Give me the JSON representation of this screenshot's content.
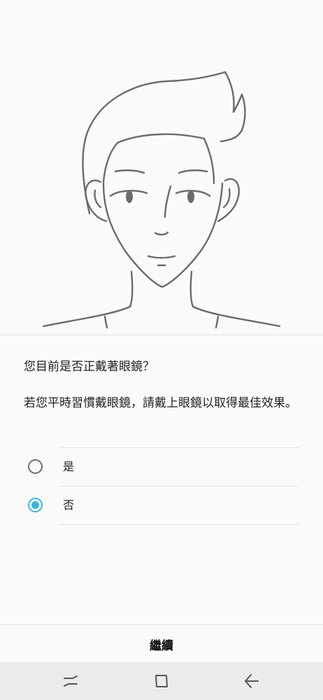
{
  "question": "您目前是否正戴著眼鏡？",
  "hint": "若您平時習慣戴眼鏡，請戴上眼鏡以取得最佳效果。",
  "options": [
    {
      "label": "是",
      "selected": false
    },
    {
      "label": "否",
      "selected": true
    }
  ],
  "continue_label": "繼續",
  "accent_color": "#3db5d8",
  "icons": {
    "illustration": "face-outline-illustration",
    "nav_recent": "recent-apps-icon",
    "nav_home": "home-icon",
    "nav_back": "back-arrow-icon"
  }
}
